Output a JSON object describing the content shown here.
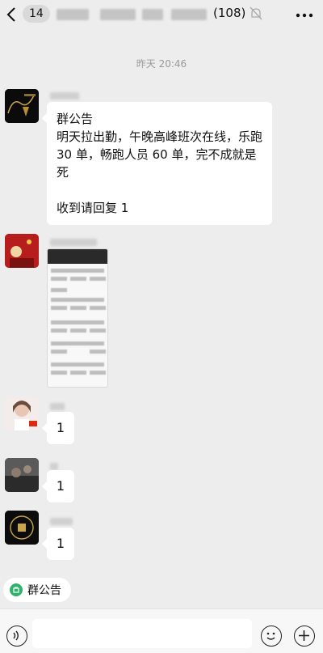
{
  "header": {
    "badge": "14",
    "member_count": "(108)"
  },
  "timestamp": "昨天 20:46",
  "messages": {
    "notice": {
      "title": "群公告",
      "body": "明天拉出勤，午晚高峰班次在线，乐跑 30 单，畅跑人员 60 单，完不成就是死",
      "reply": "收到请回复 1"
    },
    "replies": [
      "1",
      "1",
      "1"
    ]
  },
  "notice_chip": {
    "label": "群公告"
  },
  "colors": {
    "background": "#ededed",
    "bubble": "#ffffff",
    "chip_icon": "#2fb36b"
  }
}
